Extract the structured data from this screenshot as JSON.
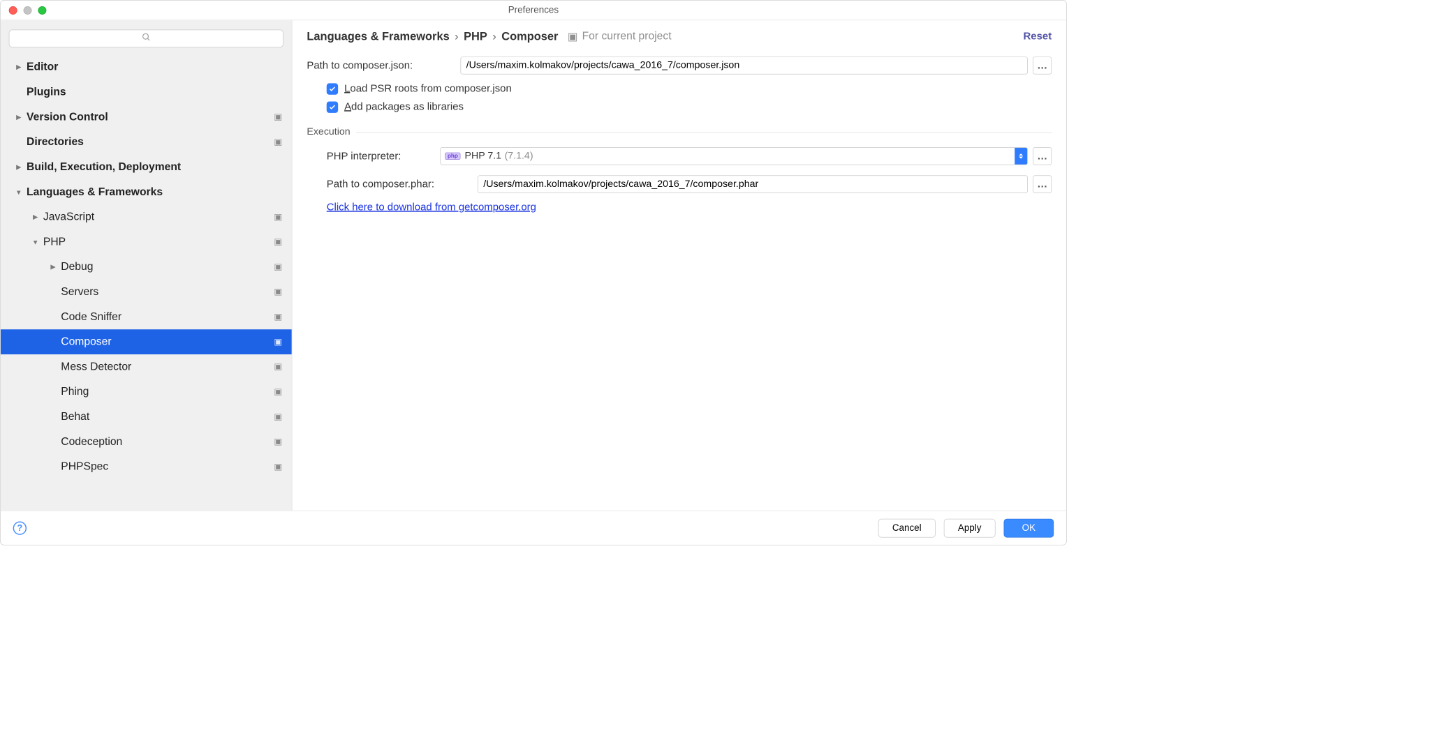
{
  "window": {
    "title": "Preferences"
  },
  "search": {
    "placeholder": ""
  },
  "sidebar": {
    "items": [
      {
        "label": "Editor",
        "bold": true,
        "caret": "right",
        "indent": 0
      },
      {
        "label": "Plugins",
        "bold": true,
        "indent": 0
      },
      {
        "label": "Version Control",
        "bold": true,
        "caret": "right",
        "indent": 0,
        "proj": true
      },
      {
        "label": "Directories",
        "bold": true,
        "indent": 0,
        "proj": true
      },
      {
        "label": "Build, Execution, Deployment",
        "bold": true,
        "caret": "right",
        "indent": 0
      },
      {
        "label": "Languages & Frameworks",
        "bold": true,
        "caret": "down",
        "indent": 0
      },
      {
        "label": "JavaScript",
        "caret": "right",
        "indent": 1,
        "proj": true
      },
      {
        "label": "PHP",
        "caret": "down",
        "indent": 1,
        "proj": true
      },
      {
        "label": "Debug",
        "caret": "right",
        "indent": 2,
        "proj": true
      },
      {
        "label": "Servers",
        "indent": 2,
        "proj": true
      },
      {
        "label": "Code Sniffer",
        "indent": 2,
        "proj": true
      },
      {
        "label": "Composer",
        "indent": 2,
        "proj": true,
        "selected": true
      },
      {
        "label": "Mess Detector",
        "indent": 2,
        "proj": true
      },
      {
        "label": "Phing",
        "indent": 2,
        "proj": true
      },
      {
        "label": "Behat",
        "indent": 2,
        "proj": true
      },
      {
        "label": "Codeception",
        "indent": 2,
        "proj": true
      },
      {
        "label": "PHPSpec",
        "indent": 2,
        "proj": true
      }
    ]
  },
  "breadcrumb": {
    "a": "Languages & Frameworks",
    "b": "PHP",
    "c": "Composer"
  },
  "scope": "For current project",
  "reset": "Reset",
  "form": {
    "pathjson_label": "Path to composer.json:",
    "pathjson_value": "/Users/maxim.kolmakov/projects/cawa_2016_7/composer.json",
    "ck1_pre": "L",
    "ck1_rest": "oad PSR roots from composer.json",
    "ck2_pre": "A",
    "ck2_rest": "dd packages as libraries",
    "exec_title": "Execution",
    "interp_label": "PHP interpreter:",
    "interp_name": "PHP 7.1",
    "interp_ver": "(7.1.4)",
    "pathphar_label": "Path to composer.phar:",
    "pathphar_value": "/Users/maxim.kolmakov/projects/cawa_2016_7/composer.phar",
    "link": "Click here to download from getcomposer.org"
  },
  "buttons": {
    "cancel": "Cancel",
    "apply": "Apply",
    "ok": "OK"
  }
}
